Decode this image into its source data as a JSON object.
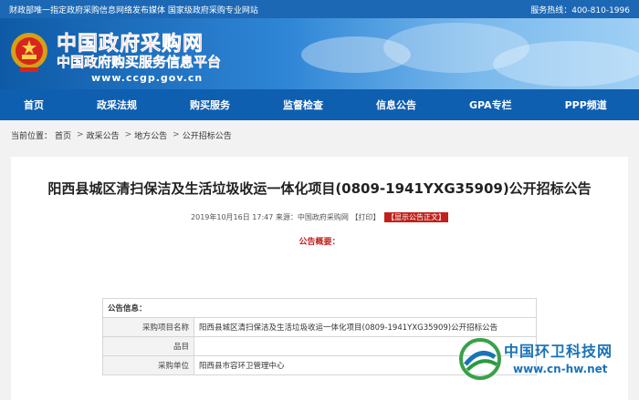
{
  "topbar": {
    "left_text": "财政部唯一指定政府采购信息网络发布媒体  国家级政府采购专业网站",
    "hotline_label": "服务热线：",
    "hotline": "400-810-1996"
  },
  "banner": {
    "title": "中国政府采购网",
    "subtitle": "中国政府购买服务信息平台",
    "url": "www.ccgp.gov.cn"
  },
  "nav": {
    "items": [
      "首页",
      "政采法规",
      "购买服务",
      "监督检查",
      "信息公告",
      "GPA专栏",
      "PPP频道"
    ]
  },
  "breadcrumb": {
    "label": "当前位置：",
    "items": [
      "首页",
      "政采公告",
      "地方公告",
      "公开招标公告"
    ]
  },
  "article": {
    "title": "阳西县城区清扫保洁及生活垃圾收运一体化项目(0809-1941YXG35909)公开招标公告",
    "datetime": "2019年10月16日 17:47",
    "source_label": "来源：",
    "source": "中国政府采购网",
    "print": "【打印】",
    "show_text": "【显示公告正文】",
    "summary_label": "公告概要："
  },
  "info_table": {
    "heading": "公告信息：",
    "rows": [
      {
        "label": "采购项目名称",
        "value": "阳西县城区清扫保洁及生活垃圾收运一体化项目(0809-1941YXG35909)公开招标公告"
      },
      {
        "label": "品目",
        "value": ""
      },
      {
        "label": "采购单位",
        "value": "阳西县市容环卫管理中心"
      }
    ]
  },
  "watermark": {
    "name": "中国环卫科技网",
    "url": "www.cn-hw.net"
  }
}
